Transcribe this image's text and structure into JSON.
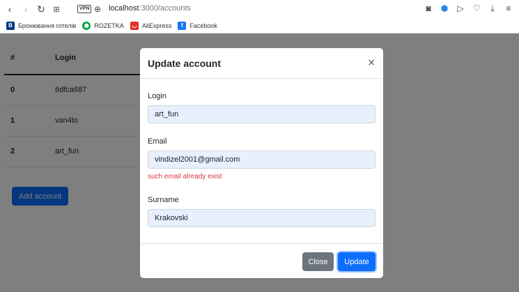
{
  "browser": {
    "url_host": "localhost",
    "url_path": ":3000/accounts",
    "vpn_label": "VPN",
    "bookmarks": [
      {
        "label": "Бронювання готелів",
        "icon": "booking-icon",
        "color": "#003580",
        "glyph": "B."
      },
      {
        "label": "ROZETKA",
        "icon": "rozetka-icon",
        "color": "#00a046",
        "glyph": "●"
      },
      {
        "label": "AliExpress",
        "icon": "aliexpress-icon",
        "color": "#e43225",
        "glyph": "◡"
      },
      {
        "label": "Facebook",
        "icon": "facebook-icon",
        "color": "#1877f2",
        "glyph": "f"
      }
    ]
  },
  "table": {
    "headers": [
      "#",
      "Login"
    ],
    "rows": [
      {
        "num": "0",
        "login": "6dfca687"
      },
      {
        "num": "1",
        "login": "van4to"
      },
      {
        "num": "2",
        "login": "art_fun"
      }
    ]
  },
  "add_button_label": "Add account",
  "modal": {
    "title": "Update account",
    "close_symbol": "×",
    "fields": {
      "login": {
        "label": "Login",
        "value": "art_fun"
      },
      "email": {
        "label": "Email",
        "value": "vindizel2001@gmail.com",
        "error": "such email already exist"
      },
      "surname": {
        "label": "Surname",
        "value": "Krakovski"
      }
    },
    "close_button_label": "Close",
    "update_button_label": "Update"
  },
  "colors": {
    "primary": "#0d6efd",
    "secondary": "#6c757d",
    "danger": "#dc3545",
    "autofill_bg": "#e8f0fe"
  }
}
